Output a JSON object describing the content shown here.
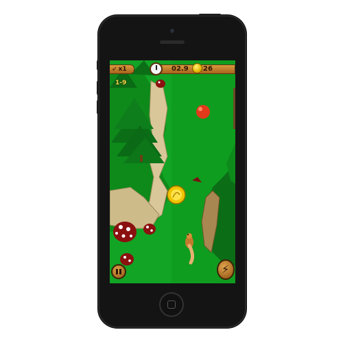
{
  "hud": {
    "multiplier": "x1",
    "timer": "02.9",
    "coins": "26",
    "level": "1-9"
  },
  "icons": {
    "multiplier": "wing-icon",
    "timer": "stopwatch-icon",
    "coins": "coin-icon",
    "pause": "pause-icon",
    "boost": "lightning-bolt-icon"
  },
  "colors": {
    "grass": "#0f9a1f",
    "hud_wood": "#c27e2c",
    "hud_text": "#2a1604",
    "level_text": "#f3d24a",
    "phone": "#141414"
  }
}
